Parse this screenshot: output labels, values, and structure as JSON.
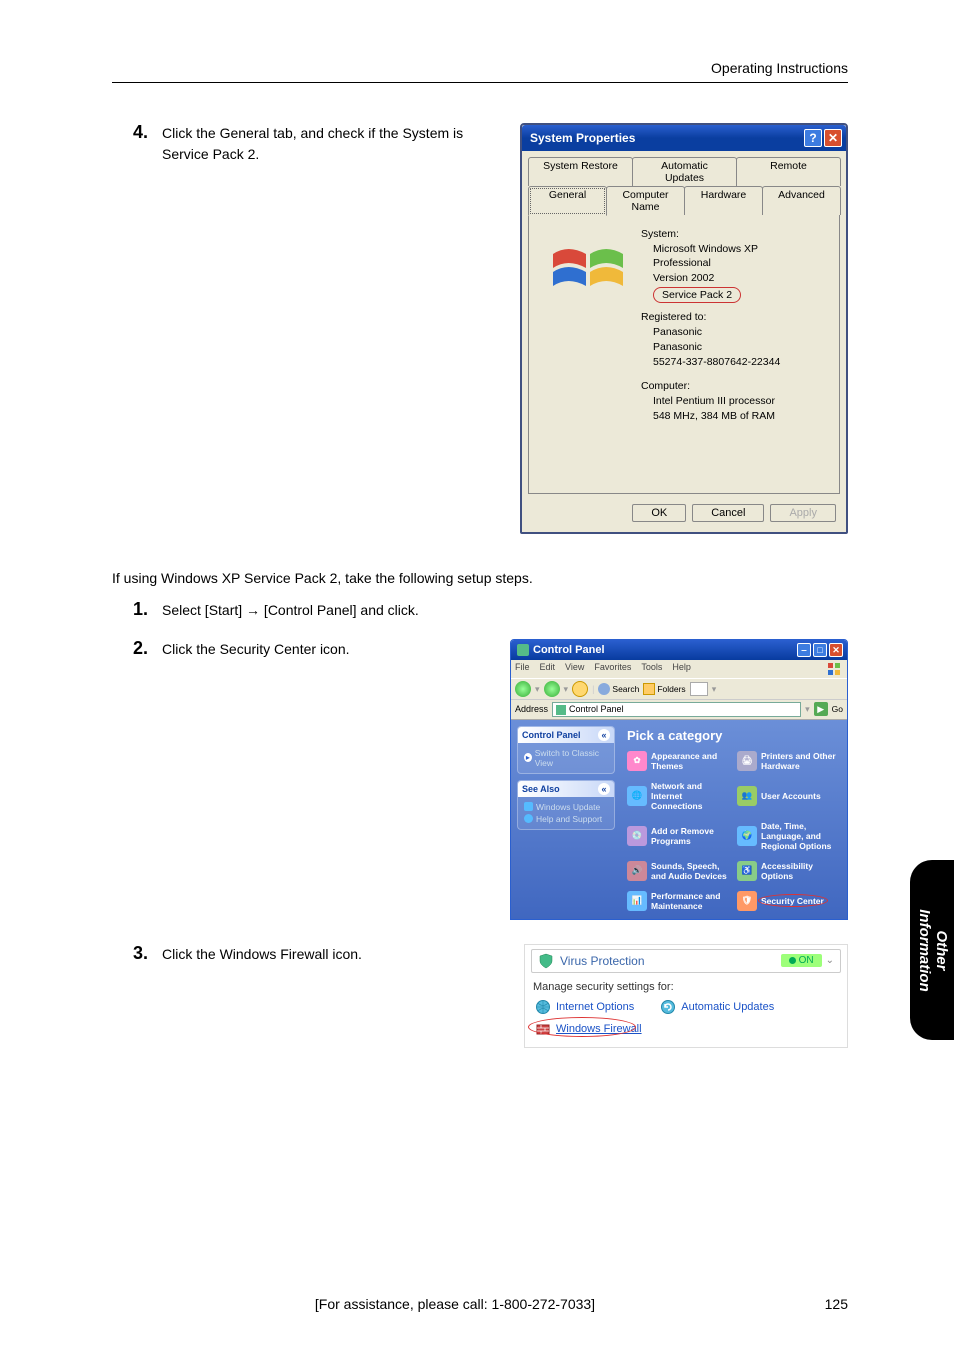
{
  "header": {
    "title": "Operating Instructions"
  },
  "step4": {
    "num": "4.",
    "text": "Click the General tab, and check if the System is Service Pack 2."
  },
  "dialog": {
    "title": "System Properties",
    "tabs_row1": [
      "System Restore",
      "Automatic Updates",
      "Remote"
    ],
    "tabs_row2": [
      "General",
      "Computer Name",
      "Hardware",
      "Advanced"
    ],
    "system_label": "System:",
    "system_lines": [
      "Microsoft Windows XP",
      "Professional",
      "Version 2002"
    ],
    "sp2": "Service Pack 2",
    "registered_label": "Registered to:",
    "registered_lines": [
      "Panasonic",
      "Panasonic",
      "55274-337-8807642-22344"
    ],
    "computer_label": "Computer:",
    "computer_lines": [
      "Intel Pentium III processor",
      "548 MHz, 384 MB of RAM"
    ],
    "ok": "OK",
    "cancel": "Cancel",
    "apply": "Apply"
  },
  "para": "If using Windows XP Service Pack 2, take the following setup steps.",
  "step1": {
    "num": "1.",
    "text": "Select [Start] → [Control Panel] and click."
  },
  "step2": {
    "num": "2.",
    "text": "Click the Security Center icon."
  },
  "step3": {
    "num": "3.",
    "text": "Click the Windows Firewall icon."
  },
  "cp": {
    "title": "Control Panel",
    "menu": [
      "File",
      "Edit",
      "View",
      "Favorites",
      "Tools",
      "Help"
    ],
    "toolbar": {
      "search": "Search",
      "folders": "Folders"
    },
    "addr_label": "Address",
    "addr_value": "Control Panel",
    "go": "Go",
    "side_hd1": "Control Panel",
    "side_item1": "Switch to Classic View",
    "side_hd2": "See Also",
    "side_items2": [
      "Windows Update",
      "Help and Support"
    ],
    "cat_title": "Pick a category",
    "cats": [
      "Appearance and Themes",
      "Printers and Other Hardware",
      "Network and Internet Connections",
      "User Accounts",
      "Add or Remove Programs",
      "Date, Time, Language, and Regional Options",
      "Sounds, Speech, and Audio Devices",
      "Accessibility Options",
      "Performance and Maintenance",
      "Security Center"
    ]
  },
  "sec": {
    "virus": "Virus Protection",
    "on": "ON",
    "manage": "Manage security settings for:",
    "internet": "Internet Options",
    "auto": "Automatic Updates",
    "firewall": "Windows Firewall"
  },
  "sidetab": {
    "line1": "Other",
    "line2": "Information"
  },
  "footer": {
    "assist": "[For assistance, please call: 1-800-272-7033]",
    "page": "125"
  }
}
